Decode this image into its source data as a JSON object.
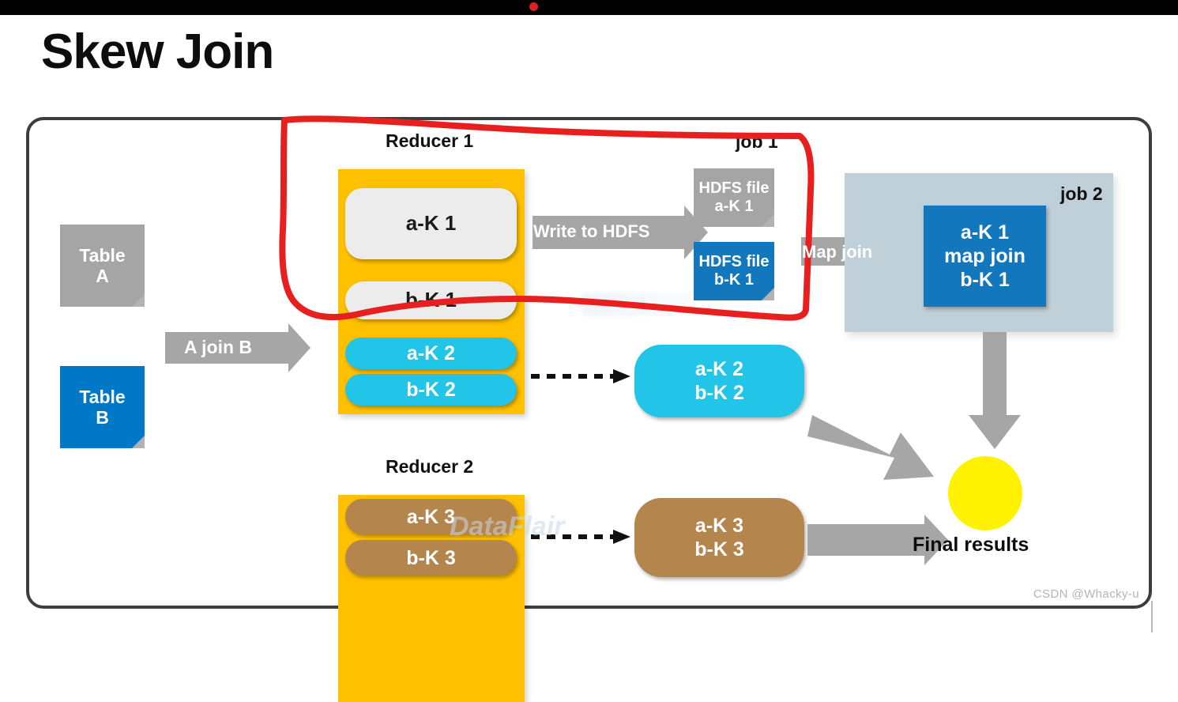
{
  "window": {
    "topbar_color": "#000000",
    "dot_color": "#e02020"
  },
  "page_title": "Skew Join",
  "diagram": {
    "border_color": "#3d3d3d",
    "inputs": [
      {
        "label_line1": "Table",
        "label_line2": "A",
        "color": "#a5a5a5",
        "name": "table-a"
      },
      {
        "label_line1": "Table",
        "label_line2": "B",
        "color": "#0078c8",
        "name": "table-b"
      }
    ],
    "join_arrow_label": "A join B",
    "reducer1": {
      "title": "Reducer 1",
      "box_color": "#FFC000",
      "items": [
        {
          "text": "a-K 1",
          "fill": "#ececec",
          "text_color": "#1a1a1a"
        },
        {
          "text": "b-K 1",
          "fill": "#ececec",
          "text_color": "#1a1a1a"
        },
        {
          "text": "a-K 2",
          "fill": "#22c4e8",
          "text_color": "#ffffff"
        },
        {
          "text": "b-K 2",
          "fill": "#22c4e8",
          "text_color": "#ffffff"
        }
      ]
    },
    "reducer2": {
      "title": "Reducer 2",
      "box_color": "#FFC000",
      "items": [
        {
          "text": "a-K 3",
          "fill": "#b5854e",
          "text_color": "#ffffff"
        },
        {
          "text": "b-K 3",
          "fill": "#b5854e",
          "text_color": "#ffffff"
        }
      ]
    },
    "write_arrow_label": "Write to HDFS",
    "job1": {
      "label": "job 1",
      "files": [
        {
          "line1": "HDFS file",
          "line2": "a-K 1",
          "color": "#a5a5a5"
        },
        {
          "line1": "HDFS file",
          "line2": "b-K 1",
          "color": "#1277bc"
        }
      ]
    },
    "map_join_arrow_label": "Map join",
    "job2": {
      "label": "job 2",
      "panel_color": "#c0d0d8",
      "box": {
        "line1": "a-K 1",
        "line2": "map join",
        "line3": "b-K 1",
        "color": "#1277bc"
      }
    },
    "output_k2": {
      "line1": "a-K 2",
      "line2": "b-K 2",
      "color": "#22c4e8"
    },
    "output_k3": {
      "line1": "a-K 3",
      "line2": "b-K 3",
      "color": "#b5854e"
    },
    "final": {
      "label": "Final results",
      "circle_color": "#FFF200"
    },
    "annotation": {
      "color": "#e81f1f",
      "shape": "hand-drawn-red-loop"
    }
  },
  "watermarks": {
    "dataflair": "DataFlair",
    "csdn": "CSDN @Whacky-u"
  }
}
